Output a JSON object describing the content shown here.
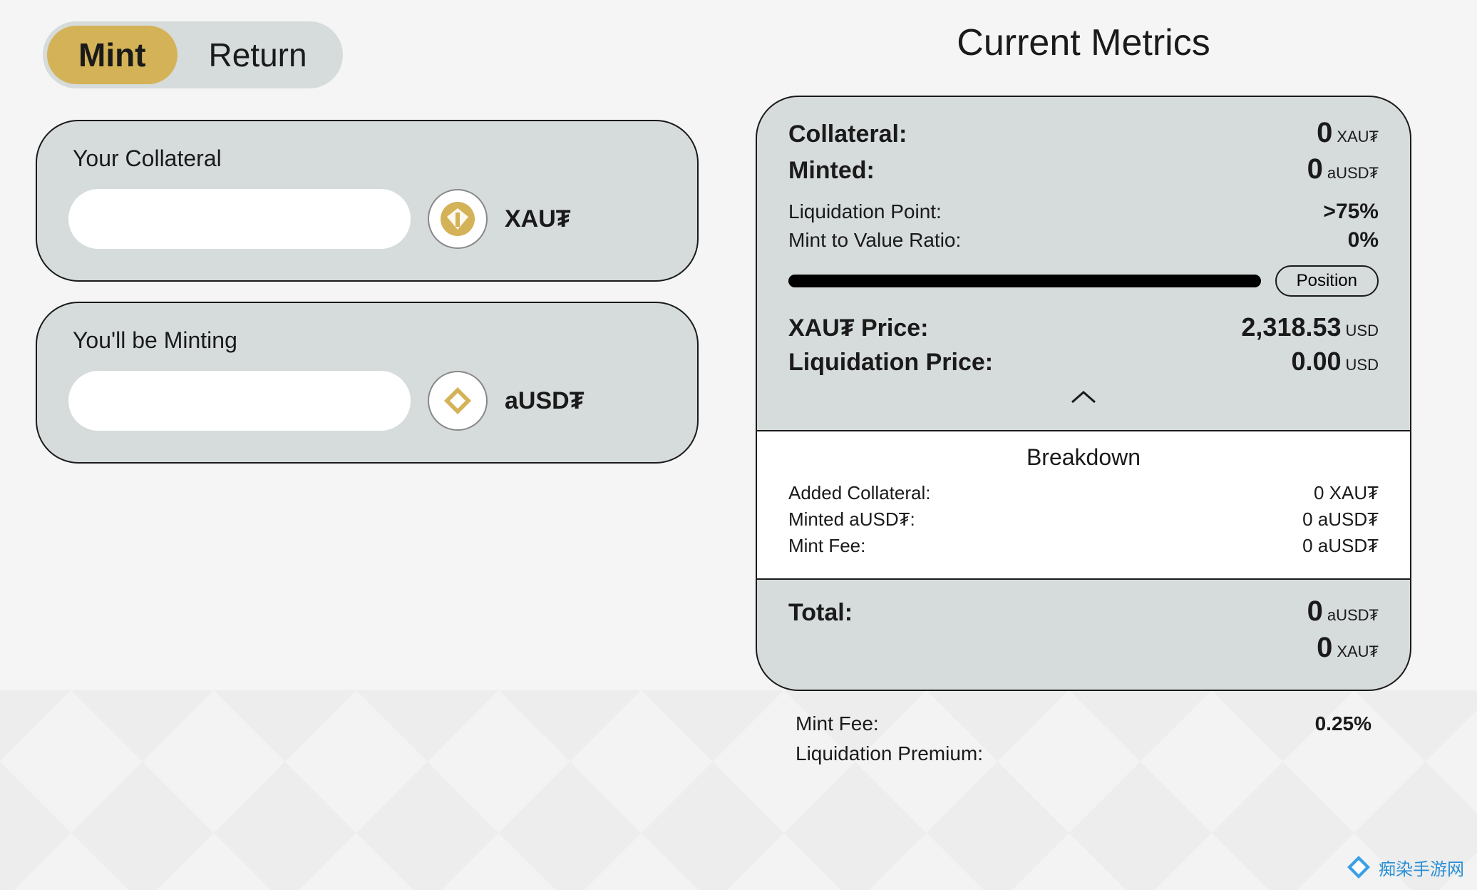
{
  "tabs": {
    "mint": "Mint",
    "return": "Return"
  },
  "collateral_card": {
    "title": "Your Collateral",
    "token": "XAU₮",
    "value": ""
  },
  "minting_card": {
    "title": "You'll be Minting",
    "token": "aUSD₮",
    "value": ""
  },
  "metrics": {
    "title": "Current Metrics",
    "collateral_label": "Collateral:",
    "collateral_value": "0",
    "collateral_unit": "XAU₮",
    "minted_label": "Minted:",
    "minted_value": "0",
    "minted_unit": "aUSD₮",
    "liq_point_label": "Liquidation Point:",
    "liq_point_value": ">75%",
    "mtv_label": "Mint to Value Ratio:",
    "mtv_value": "0%",
    "position_btn": "Position",
    "xaut_price_label": "XAU₮ Price:",
    "xaut_price_value": "2,318.53",
    "xaut_price_unit": "USD",
    "liq_price_label": "Liquidation Price:",
    "liq_price_value": "0.00",
    "liq_price_unit": "USD"
  },
  "breakdown": {
    "title": "Breakdown",
    "rows": [
      {
        "label": "Added Collateral:",
        "value": "0 XAU₮"
      },
      {
        "label": "Minted aUSD₮:",
        "value": "0 aUSD₮"
      },
      {
        "label": "Mint Fee:",
        "value": "0 aUSD₮"
      }
    ]
  },
  "totals": {
    "label": "Total:",
    "v1": "0",
    "u1": "aUSD₮",
    "v2": "0",
    "u2": "XAU₮"
  },
  "below": {
    "mint_fee_label": "Mint Fee:",
    "mint_fee_value": "0.25%",
    "liq_premium_label": "Liquidation Premium:",
    "liq_premium_value": ""
  },
  "watermark": "痴染手游网"
}
